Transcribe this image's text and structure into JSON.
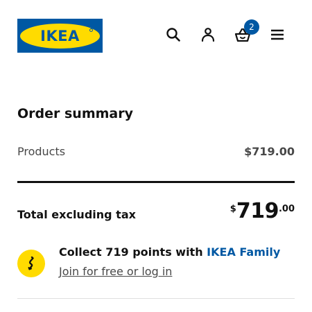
{
  "header": {
    "logo_text": "IKEA",
    "basket_count": "2",
    "icons": [
      "search-icon",
      "user-icon",
      "basket-icon",
      "menu-icon"
    ]
  },
  "order_summary": {
    "title": "Order summary",
    "products_label": "Products",
    "products_value": "$719.00",
    "total_label": "Total excluding tax",
    "total_currency": "$",
    "total_integer": "719",
    "total_decimals": ".00"
  },
  "loyalty": {
    "text_prefix": "Collect 719 points with ",
    "brand": "IKEA Family",
    "link_text": "Join for free or log in",
    "icon": "loyalty-icon"
  },
  "colors": {
    "brand_blue": "#0058a3",
    "brand_yellow": "#ffdb00",
    "text_dark": "#111111",
    "text_muted": "#484848",
    "divider_light": "#dfdfdf"
  }
}
